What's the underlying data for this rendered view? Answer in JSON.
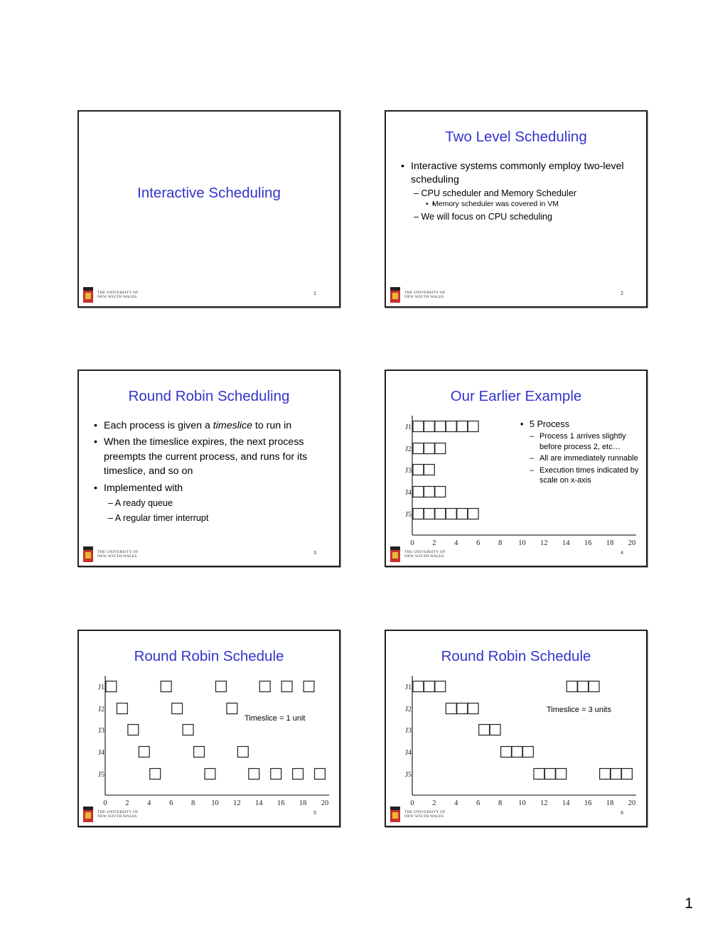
{
  "document": {
    "page_number": "1",
    "university_line1": "THE UNIVERSITY OF",
    "university_line2": "NEW SOUTH WALES",
    "title_color": "#3333CC"
  },
  "slides": [
    {
      "number": "1",
      "title": "Interactive Scheduling"
    },
    {
      "number": "2",
      "title": "Two Level Scheduling",
      "bullets": [
        {
          "level": 1,
          "text": "Interactive systems commonly employ two-level scheduling"
        },
        {
          "level": 2,
          "text": "– CPU scheduler and Memory Scheduler"
        },
        {
          "level": 3,
          "text": "Memory scheduler was covered in VM"
        },
        {
          "level": 2,
          "text": "– We will focus on CPU scheduling"
        }
      ]
    },
    {
      "number": "3",
      "title": "Round Robin Scheduling",
      "bullets": [
        {
          "level": 1,
          "text_before": "Each process is given a ",
          "text_italic": "timeslice",
          "text_after": " to run in"
        },
        {
          "level": 1,
          "text": "When the timeslice expires, the next process preempts the current process, and runs for its timeslice, and so on"
        },
        {
          "level": 1,
          "text": "Implemented with"
        },
        {
          "level": 2,
          "text": "– A ready queue"
        },
        {
          "level": 2,
          "text": "– A regular timer interrupt"
        }
      ]
    },
    {
      "number": "4",
      "title": "Our Earlier Example",
      "bullets": [
        {
          "level": 1,
          "text": "5 Process"
        },
        {
          "level": 2,
          "text": "Process 1 arrives slightly before process 2, etc…"
        },
        {
          "level": 2,
          "text": "All are immediately runnable"
        },
        {
          "level": 2,
          "text": "Execution times indicated by scale on x-axis"
        }
      ]
    },
    {
      "number": "5",
      "title": "Round Robin Schedule",
      "annotation": "Timeslice = 1 unit"
    },
    {
      "number": "6",
      "title": "Round Robin Schedule",
      "annotation": "Timeslice = 3 units"
    }
  ],
  "chart_data": [
    {
      "type": "gantt",
      "slide": "4",
      "title": "Our Earlier Example",
      "categories": [
        "J1",
        "J2",
        "J3",
        "J4",
        "J5"
      ],
      "xlim": [
        0,
        20
      ],
      "xticks": [
        "0",
        "2",
        "4",
        "6",
        "8",
        "10",
        "12",
        "14",
        "16",
        "18",
        "20"
      ],
      "unit_boxes": true,
      "series": [
        {
          "name": "J1",
          "segments": [
            [
              0,
              6
            ]
          ]
        },
        {
          "name": "J2",
          "segments": [
            [
              0,
              3
            ]
          ]
        },
        {
          "name": "J3",
          "segments": [
            [
              0,
              2
            ]
          ]
        },
        {
          "name": "J4",
          "segments": [
            [
              0,
              3
            ]
          ]
        },
        {
          "name": "J5",
          "segments": [
            [
              0,
              6
            ]
          ]
        }
      ]
    },
    {
      "type": "gantt",
      "slide": "5",
      "title": "Round Robin Schedule",
      "annotation": "Timeslice = 1 unit",
      "categories": [
        "J1",
        "J2",
        "J3",
        "J4",
        "J5"
      ],
      "xlim": [
        0,
        20
      ],
      "xticks": [
        "0",
        "2",
        "4",
        "6",
        "8",
        "10",
        "12",
        "14",
        "16",
        "18",
        "20"
      ],
      "unit_boxes": true,
      "series": [
        {
          "name": "J1",
          "segments": [
            [
              0,
              1
            ],
            [
              5,
              6
            ],
            [
              10,
              11
            ],
            [
              14,
              15
            ],
            [
              16,
              17
            ],
            [
              18,
              19
            ]
          ]
        },
        {
          "name": "J2",
          "segments": [
            [
              1,
              2
            ],
            [
              6,
              7
            ],
            [
              11,
              12
            ]
          ]
        },
        {
          "name": "J3",
          "segments": [
            [
              2,
              3
            ],
            [
              7,
              8
            ]
          ]
        },
        {
          "name": "J4",
          "segments": [
            [
              3,
              4
            ],
            [
              8,
              9
            ],
            [
              12,
              13
            ]
          ]
        },
        {
          "name": "J5",
          "segments": [
            [
              4,
              5
            ],
            [
              9,
              10
            ],
            [
              13,
              14
            ],
            [
              15,
              16
            ],
            [
              17,
              18
            ],
            [
              19,
              20
            ]
          ]
        }
      ]
    },
    {
      "type": "gantt",
      "slide": "6",
      "title": "Round Robin Schedule",
      "annotation": "Timeslice = 3 units",
      "categories": [
        "J1",
        "J2",
        "J3",
        "J4",
        "J5"
      ],
      "xlim": [
        0,
        20
      ],
      "xticks": [
        "0",
        "2",
        "4",
        "6",
        "8",
        "10",
        "12",
        "14",
        "16",
        "18",
        "20"
      ],
      "unit_boxes": true,
      "series": [
        {
          "name": "J1",
          "segments": [
            [
              0,
              3
            ],
            [
              14,
              17
            ]
          ]
        },
        {
          "name": "J2",
          "segments": [
            [
              3,
              6
            ]
          ]
        },
        {
          "name": "J3",
          "segments": [
            [
              6,
              8
            ]
          ]
        },
        {
          "name": "J4",
          "segments": [
            [
              8,
              11
            ]
          ]
        },
        {
          "name": "J5",
          "segments": [
            [
              11,
              14
            ],
            [
              17,
              20
            ]
          ]
        }
      ]
    }
  ]
}
